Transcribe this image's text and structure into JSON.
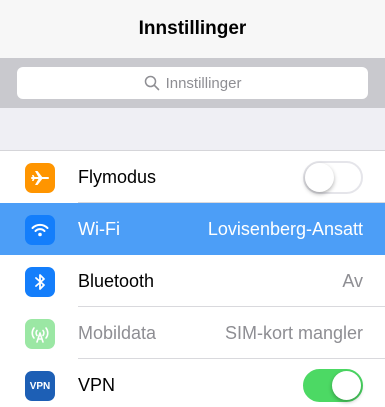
{
  "header": {
    "title": "Innstillinger"
  },
  "search": {
    "placeholder": "Innstillinger",
    "icon": "search-icon"
  },
  "colors": {
    "selected_row": "#4c9ef7",
    "airplane_icon_bg": "#ff9500",
    "wifi_icon_bg": "#147efb",
    "bluetooth_icon_bg": "#147efb",
    "cellular_icon_bg_disabled": "#9be7a4",
    "vpn_icon_bg": "#1d5fb5",
    "toggle_on": "#4cd964"
  },
  "rows": [
    {
      "label": "Flymodus",
      "icon": "airplane-icon",
      "toggle": false
    },
    {
      "label": "Wi-Fi",
      "icon": "wifi-icon",
      "value": "Lovisenberg-Ansatt",
      "selected": true
    },
    {
      "label": "Bluetooth",
      "icon": "bluetooth-icon",
      "value": "Av"
    },
    {
      "label": "Mobildata",
      "icon": "cellular-icon",
      "value": "SIM-kort mangler",
      "disabled": true
    },
    {
      "label": "VPN",
      "icon": "vpn-icon",
      "icon_text": "VPN",
      "toggle": true
    }
  ]
}
